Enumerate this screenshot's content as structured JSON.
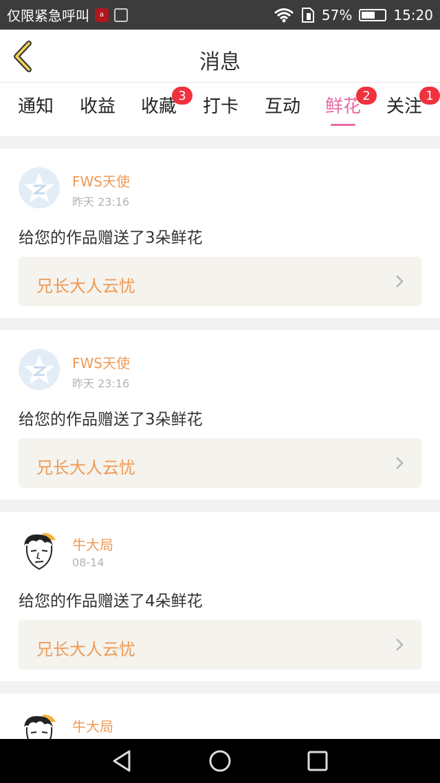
{
  "status_bar": {
    "left_text": "仅限紧急呼叫",
    "left_icon_text": "a",
    "battery_percent": "57%",
    "battery_level": 0.57,
    "time": "15:20",
    "icons": [
      "app-notification-icon",
      "image-notification-icon",
      "wifi-icon",
      "sim-icon",
      "battery-icon"
    ]
  },
  "header": {
    "title": "消息",
    "back_icon": "chevron-left-icon"
  },
  "tabs": [
    {
      "label": "通知",
      "badge": ""
    },
    {
      "label": "收益",
      "badge": ""
    },
    {
      "label": "收藏",
      "badge": "3"
    },
    {
      "label": "打卡",
      "badge": ""
    },
    {
      "label": "互动",
      "badge": ""
    },
    {
      "label": "鲜花",
      "badge": "2",
      "active": true
    },
    {
      "label": "关注",
      "badge": "1"
    }
  ],
  "messages": [
    {
      "name": "FWS天使",
      "time": "昨天 23:16",
      "text": "给您的作品赠送了3朵鲜花",
      "work": "兄长大人云忧",
      "avatar": "qzone-star-avatar"
    },
    {
      "name": "FWS天使",
      "time": "昨天 23:16",
      "text": "给您的作品赠送了3朵鲜花",
      "work": "兄长大人云忧",
      "avatar": "qzone-star-avatar"
    },
    {
      "name": "牛大局",
      "time": "08-14",
      "text": "给您的作品赠送了4朵鲜花",
      "work": "兄长大人云忧",
      "avatar": "cartoon-face-avatar"
    },
    {
      "name": "牛大局",
      "time": "",
      "text": "",
      "work": "",
      "avatar": "cartoon-face-avatar"
    }
  ],
  "nav_bar": {
    "icons": [
      "back-triangle-icon",
      "home-circle-icon",
      "recents-square-icon"
    ]
  },
  "colors": {
    "accent_pink": "#e86aa4",
    "name_orange": "#ef9a56",
    "badge_red": "#f0313e",
    "link_bg": "#f5f3ed"
  }
}
